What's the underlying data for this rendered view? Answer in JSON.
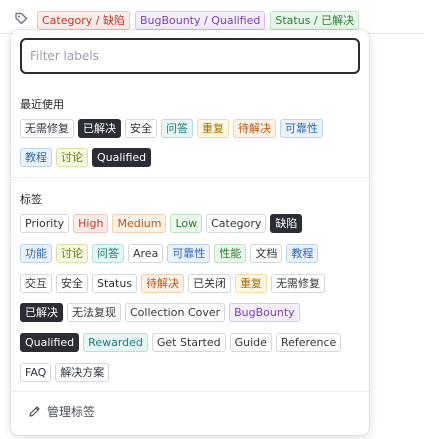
{
  "header": {
    "chips": [
      {
        "label": "Category / 缺陷",
        "color": "red"
      },
      {
        "label": "BugBounty / Qualified",
        "color": "purple"
      },
      {
        "label": "Status / 已解决",
        "color": "green"
      }
    ]
  },
  "popover": {
    "filter_placeholder": "Filter labels",
    "recent_title": "最近使用",
    "recent_rows": [
      [
        {
          "label": "无需修复",
          "color": "gray"
        },
        {
          "label": "已解决",
          "color": "dark"
        },
        {
          "label": "安全",
          "color": "gray"
        },
        {
          "label": "问答",
          "color": "teal"
        },
        {
          "label": "重复",
          "color": "yellow"
        },
        {
          "label": "待解决",
          "color": "orange"
        },
        {
          "label": "可靠性",
          "color": "blue"
        }
      ],
      [
        {
          "label": "教程",
          "color": "blue"
        },
        {
          "label": "讨论",
          "color": "olive"
        },
        {
          "label": "Qualified",
          "color": "dark"
        }
      ]
    ],
    "labels_title": "标签",
    "label_rows": [
      [
        {
          "label": "Priority",
          "color": "gray"
        },
        {
          "label": "High",
          "color": "red"
        },
        {
          "label": "Medium",
          "color": "orange"
        },
        {
          "label": "Low",
          "color": "green"
        },
        {
          "label": "Category",
          "color": "gray"
        },
        {
          "label": "缺陷",
          "color": "dark"
        }
      ],
      [
        {
          "label": "功能",
          "color": "blue"
        },
        {
          "label": "讨论",
          "color": "olive"
        },
        {
          "label": "问答",
          "color": "teal"
        },
        {
          "label": "Area",
          "color": "gray"
        },
        {
          "label": "可靠性",
          "color": "blue"
        },
        {
          "label": "性能",
          "color": "green"
        },
        {
          "label": "文档",
          "color": "gray"
        },
        {
          "label": "教程",
          "color": "blue"
        }
      ],
      [
        {
          "label": "交互",
          "color": "gray"
        },
        {
          "label": "安全",
          "color": "gray"
        },
        {
          "label": "Status",
          "color": "gray"
        },
        {
          "label": "待解决",
          "color": "orange"
        },
        {
          "label": "已关闭",
          "color": "gray"
        },
        {
          "label": "重复",
          "color": "yellow"
        },
        {
          "label": "无需修复",
          "color": "gray"
        }
      ],
      [
        {
          "label": "已解决",
          "color": "dark"
        },
        {
          "label": "无法复现",
          "color": "gray"
        },
        {
          "label": "Collection Cover",
          "color": "gray"
        },
        {
          "label": "BugBounty",
          "color": "purple"
        }
      ],
      [
        {
          "label": "Qualified",
          "color": "dark"
        },
        {
          "label": "Rewarded",
          "color": "teal"
        },
        {
          "label": "Get Started",
          "color": "gray"
        },
        {
          "label": "Guide",
          "color": "gray"
        },
        {
          "label": "Reference",
          "color": "gray"
        }
      ],
      [
        {
          "label": "FAQ",
          "color": "gray"
        },
        {
          "label": "解决方案",
          "color": "gray"
        }
      ]
    ],
    "manage_label": "管理标签"
  },
  "icons": {
    "header": "tag-icon",
    "manage": "pencil-icon"
  }
}
